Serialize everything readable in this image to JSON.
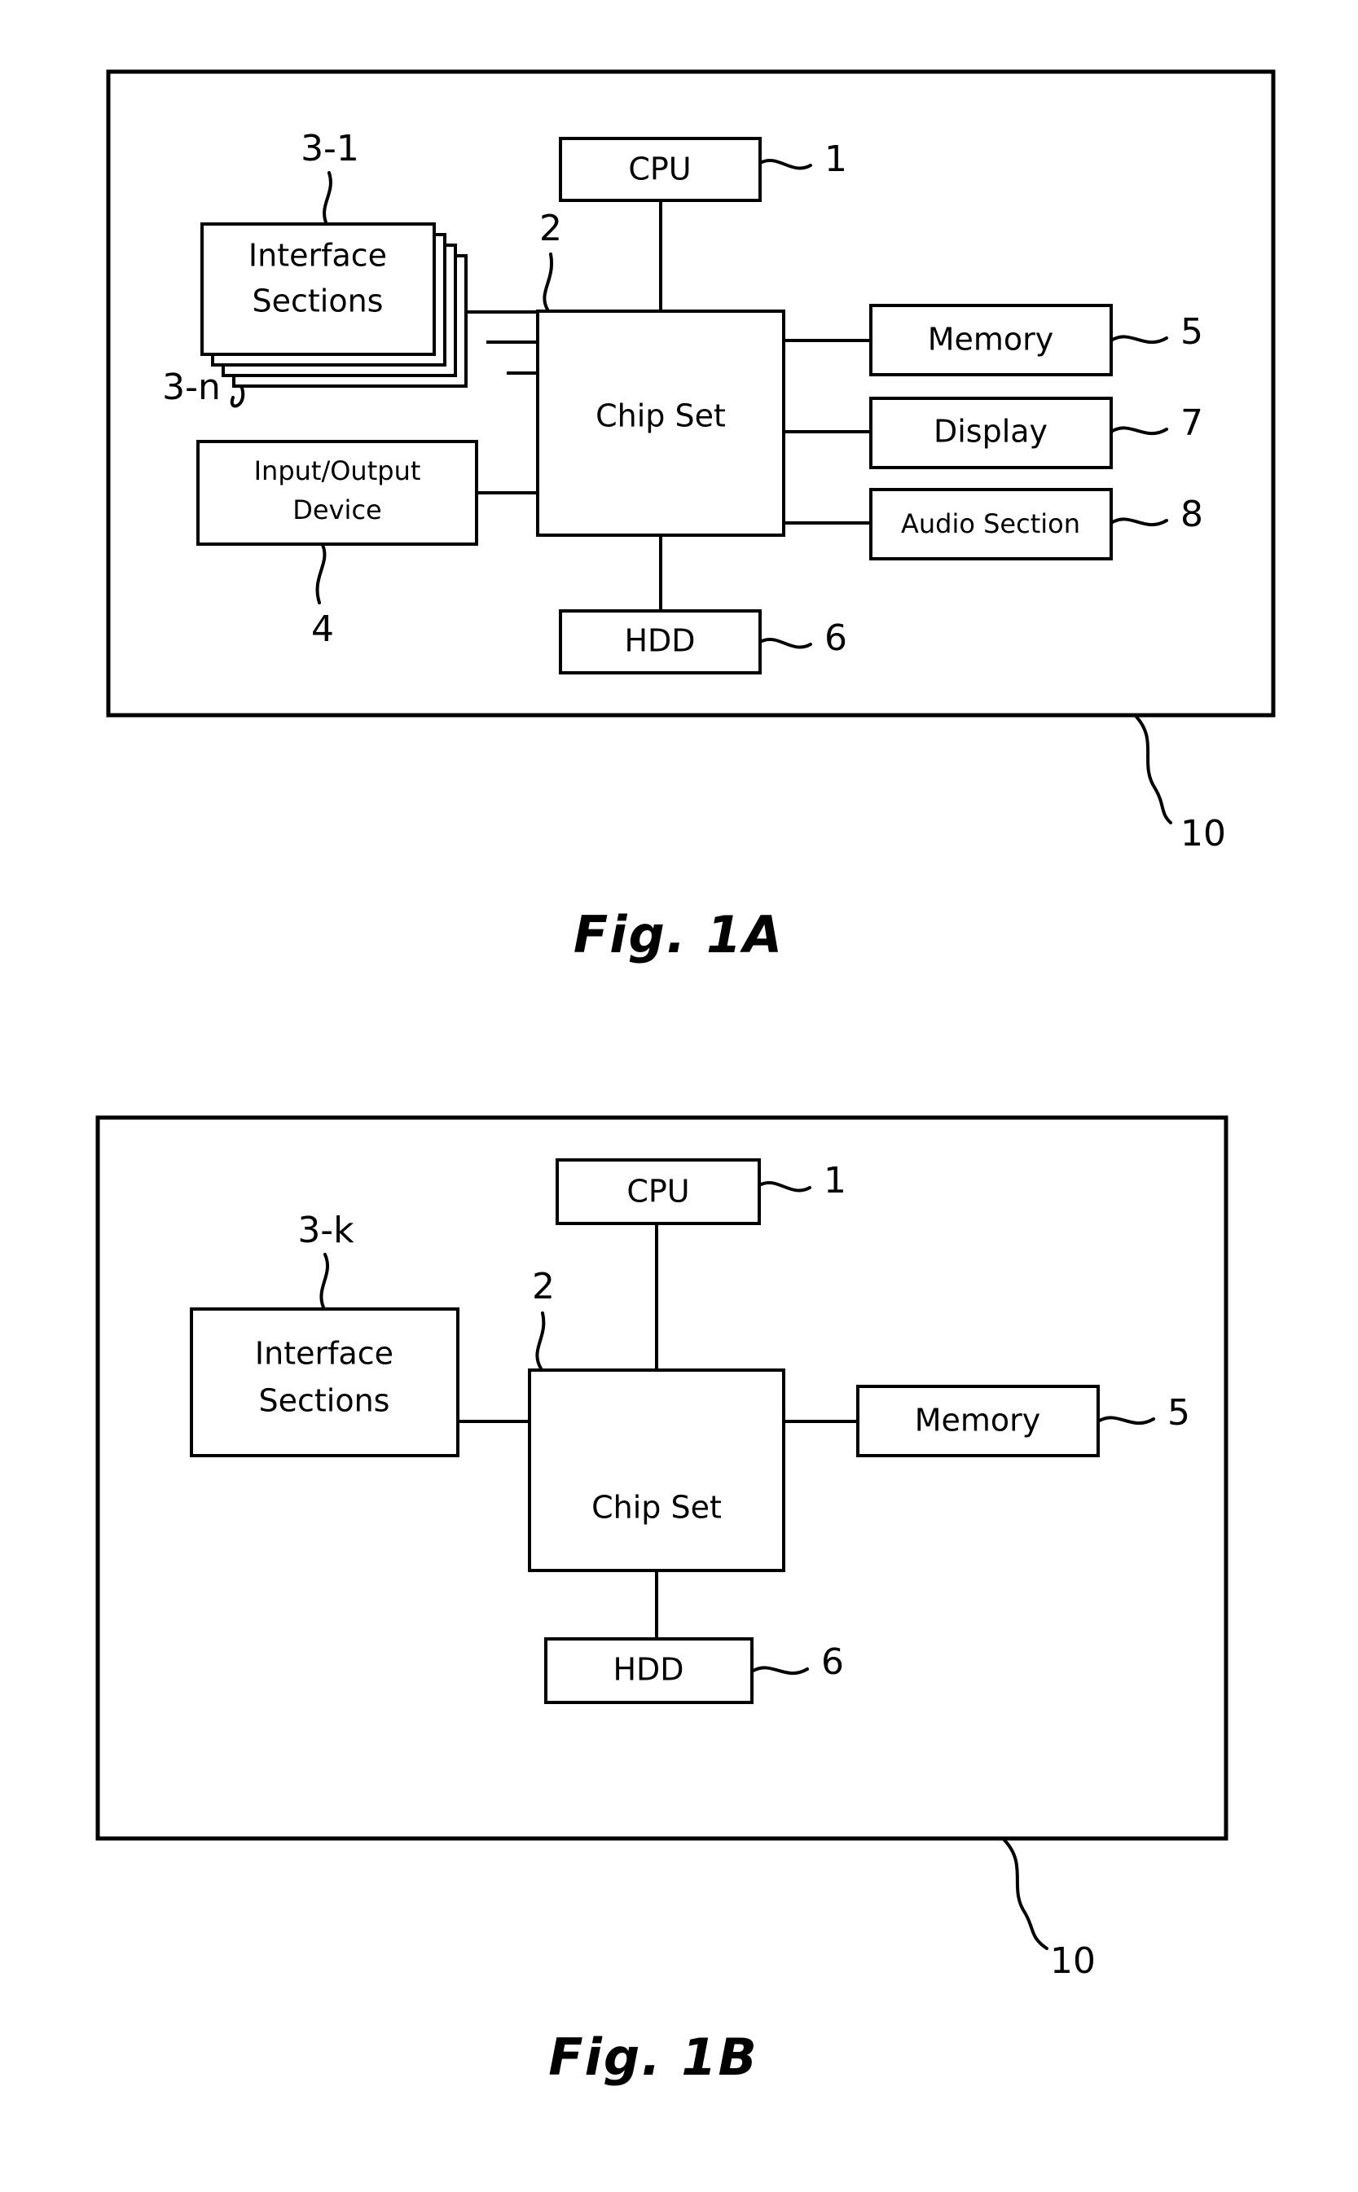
{
  "document": {
    "type": "patent-drawing-sheet",
    "figures": [
      {
        "id": "fig1a",
        "caption": "Fig. 1A",
        "system_ref": "10",
        "blocks": [
          {
            "key": "cpu",
            "label": "CPU",
            "ref": "1"
          },
          {
            "key": "chipset",
            "label": "Chip Set",
            "ref": "2"
          },
          {
            "key": "interface",
            "label_line1": "Interface",
            "label_line2": "Sections",
            "ref_top": "3-1",
            "ref_bottom": "3-n",
            "stacked": true
          },
          {
            "key": "io",
            "label_line1": "Input/Output",
            "label_line2": "Device",
            "ref": "4"
          },
          {
            "key": "memory",
            "label": "Memory",
            "ref": "5"
          },
          {
            "key": "hdd",
            "label": "HDD",
            "ref": "6"
          },
          {
            "key": "display",
            "label": "Display",
            "ref": "7"
          },
          {
            "key": "audio",
            "label": "Audio Section",
            "ref": "8"
          }
        ]
      },
      {
        "id": "fig1b",
        "caption": "Fig. 1B",
        "system_ref": "10",
        "blocks": [
          {
            "key": "cpu",
            "label": "CPU",
            "ref": "1"
          },
          {
            "key": "chipset",
            "label": "Chip Set",
            "ref": "2"
          },
          {
            "key": "interface",
            "label_line1": "Interface",
            "label_line2": "Sections",
            "ref": "3-k"
          },
          {
            "key": "memory",
            "label": "Memory",
            "ref": "5"
          },
          {
            "key": "hdd",
            "label": "HDD",
            "ref": "6"
          }
        ]
      }
    ]
  },
  "fig1a": {
    "caption": "Fig. 1A",
    "cpu_label": "CPU",
    "cpu_ref": "1",
    "chipset_label": "Chip Set",
    "chipset_ref": "2",
    "interface_label_1": "Interface",
    "interface_label_2": "Sections",
    "interface_ref_top": "3-1",
    "interface_ref_bottom": "3-n",
    "io_label_1": "Input/Output",
    "io_label_2": "Device",
    "io_ref": "4",
    "memory_label": "Memory",
    "memory_ref": "5",
    "hdd_label": "HDD",
    "hdd_ref": "6",
    "display_label": "Display",
    "display_ref": "7",
    "audio_label": "Audio Section",
    "audio_ref": "8",
    "system_ref": "10"
  },
  "fig1b": {
    "caption": "Fig. 1B",
    "cpu_label": "CPU",
    "cpu_ref": "1",
    "chipset_label": "Chip Set",
    "chipset_ref": "2",
    "interface_label_1": "Interface",
    "interface_label_2": "Sections",
    "interface_ref": "3-k",
    "memory_label": "Memory",
    "memory_ref": "5",
    "hdd_label": "HDD",
    "hdd_ref": "6",
    "system_ref": "10"
  },
  "colors": {
    "ink": "#000000",
    "paper": "#ffffff"
  }
}
